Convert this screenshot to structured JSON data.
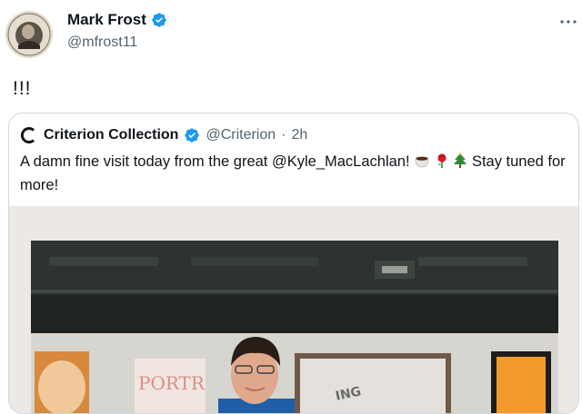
{
  "tweet": {
    "author_name": "Mark Frost",
    "author_handle": "@mfrost11",
    "text": "!!!"
  },
  "quoted_tweet": {
    "author_name": "Criterion Collection",
    "author_handle": "@Criterion",
    "separator": "·",
    "time": "2h",
    "text_before": "A damn fine visit today from the great @Kyle_MacLachlan!",
    "text_after": "Stay tuned for more!",
    "emojis": [
      "coffee-icon",
      "rose-icon",
      "tree-icon"
    ],
    "photo_sign_text": "PORTR"
  },
  "icons": {
    "more": "more-options-icon",
    "verified": "verified-badge-icon"
  },
  "colors": {
    "verified_blue": "#1d9bf0",
    "secondary_text": "#536471",
    "border": "#cfd9de"
  }
}
